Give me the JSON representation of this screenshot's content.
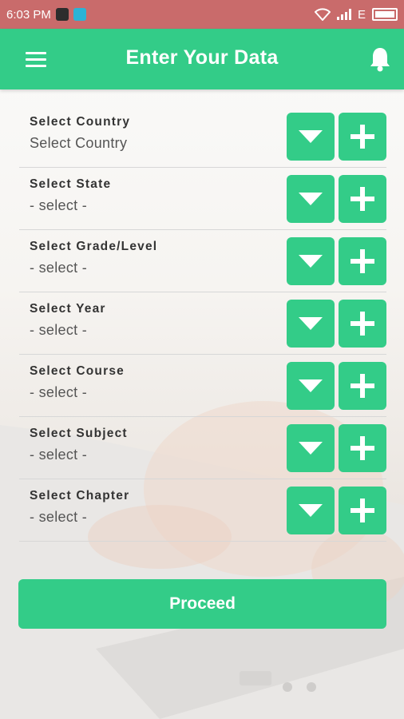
{
  "status_bar": {
    "time": "6:03 PM",
    "network": "E"
  },
  "app_bar": {
    "title": "Enter Your Data",
    "menu_icon": "menu-icon",
    "notification_icon": "bell-icon"
  },
  "colors": {
    "accent": "#33cc88",
    "status_bar": "#c96b6b"
  },
  "fields": [
    {
      "label": "Select Country",
      "value": "Select Country"
    },
    {
      "label": "Select State",
      "value": "- select -"
    },
    {
      "label": "Select Grade/Level",
      "value": "- select -"
    },
    {
      "label": "Select Year",
      "value": "- select -"
    },
    {
      "label": "Select Course",
      "value": "- select -"
    },
    {
      "label": "Select Subject",
      "value": "- select -"
    },
    {
      "label": "Select Chapter",
      "value": "- select -"
    }
  ],
  "proceed_label": "Proceed"
}
